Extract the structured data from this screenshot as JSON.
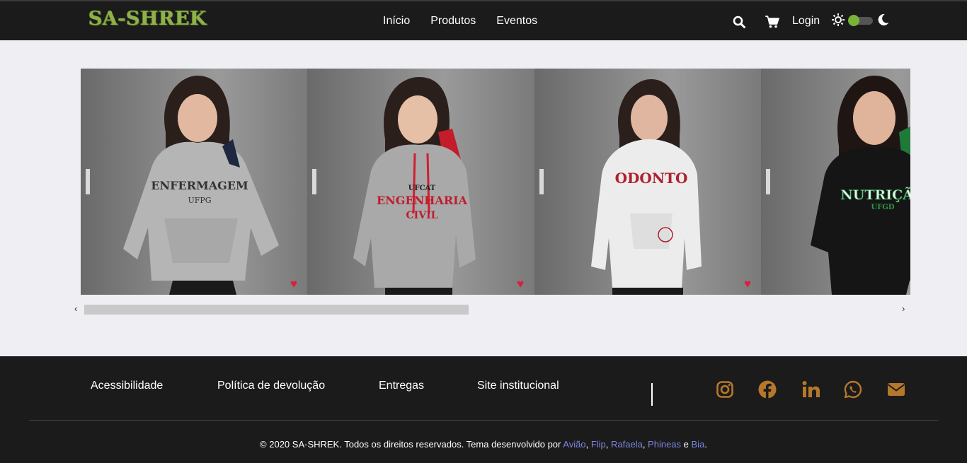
{
  "brand": {
    "logo_text": "SA-SHREK"
  },
  "nav": {
    "links": [
      "Início",
      "Produtos",
      "Eventos"
    ],
    "login_label": "Login"
  },
  "carousel": {
    "slides": [
      {
        "product": "ENFERMAGEM UFPG",
        "hoodie_color": "gray"
      },
      {
        "product": "UFCAT ENGENHARIA CIVIL",
        "hoodie_color": "gray"
      },
      {
        "product": "ODONTO",
        "hoodie_color": "white"
      },
      {
        "product": "NUTRIÇÃO UFGD",
        "hoodie_color": "black"
      }
    ],
    "scroll_position_fraction": 0.47
  },
  "footer": {
    "links": [
      "Acessibilidade",
      "Política de devolução",
      "Entregas",
      "Site institucional"
    ],
    "social_icons": [
      "instagram-icon",
      "facebook-icon",
      "linkedin-icon",
      "whatsapp-icon",
      "email-icon"
    ],
    "copyright_prefix": "© 2020 SA-SHREK. Todos os direitos reservados. Tema desenvolvido por",
    "authors": [
      "Avião",
      "Flip",
      "Rafaela",
      "Phineas",
      "Bia"
    ],
    "conjunction": "e"
  },
  "colors": {
    "navbar_bg": "#1b1b1b",
    "footer_bg": "#1b1b1b",
    "social_accent": "#b5782a",
    "author_link": "#7b86e0",
    "logo_green": "#8fb04a"
  }
}
